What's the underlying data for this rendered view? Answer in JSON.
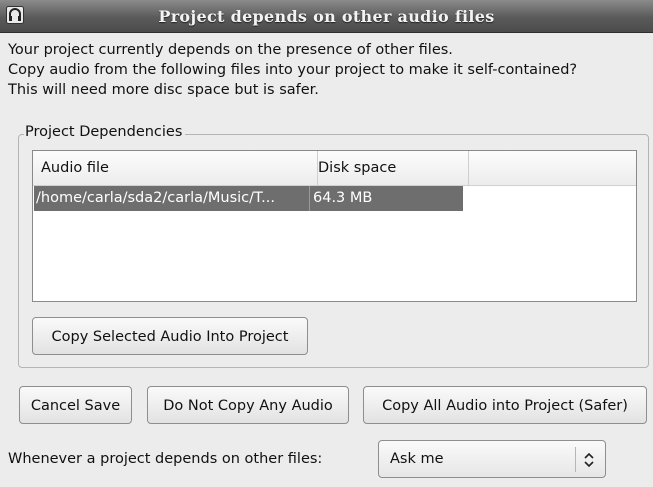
{
  "window": {
    "title": "Project depends on other audio files",
    "app_icon": "headphones-icon"
  },
  "intro": {
    "line1": "Your project currently depends on the presence of other files.",
    "line2": "Copy audio from the following files into your project to make it self-contained?",
    "line3": "This will need more disc space but is safer."
  },
  "dependencies": {
    "group_title": "Project Dependencies",
    "columns": [
      "Audio file",
      "Disk space"
    ],
    "rows": [
      {
        "file": "/home/carla/sda2/carla/Music/T...",
        "size": "64.3 MB",
        "selected": true
      }
    ],
    "copy_selected_label": "Copy Selected Audio Into Project"
  },
  "actions": {
    "cancel_label": "Cancel Save",
    "no_copy_label": "Do Not Copy Any Audio",
    "copy_all_label": "Copy All Audio into Project (Safer)"
  },
  "footer": {
    "prompt": "Whenever a project depends on other files:",
    "selected_option": "Ask me"
  },
  "colors": {
    "selection": "#6e6e6e",
    "titlebar": "#5a5a5a"
  }
}
